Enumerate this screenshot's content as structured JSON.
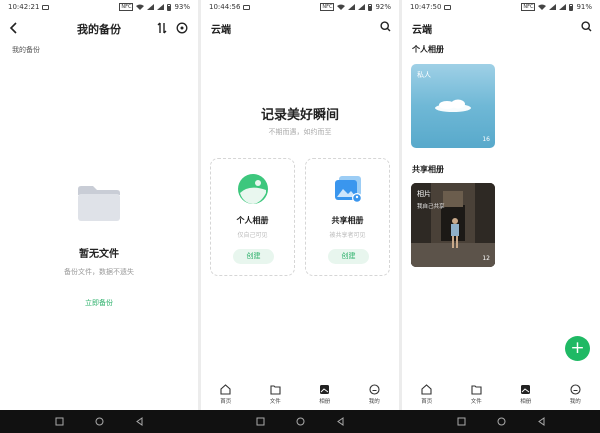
{
  "screens": [
    {
      "status": {
        "time": "10:42:21",
        "battery": "93%"
      },
      "header": {
        "title": "我的备份"
      },
      "section_label": "我的备份",
      "empty": {
        "title": "暂无文件",
        "subtitle": "备份文件，数据不遗失",
        "action": "立即备份"
      }
    },
    {
      "status": {
        "time": "10:44:56",
        "battery": "92%"
      },
      "app_title": "云端",
      "hero": {
        "title": "记录美好瞬间",
        "subtitle": "不期而遇，如约而至"
      },
      "cards": [
        {
          "title": "个人相册",
          "subtitle": "仅自己可见",
          "button": "创建"
        },
        {
          "title": "共享相册",
          "subtitle": "被共享者可见",
          "button": "创建"
        }
      ]
    },
    {
      "status": {
        "time": "10:47:50",
        "battery": "91%"
      },
      "app_title": "云端",
      "personal_section": "个人相册",
      "shared_section": "共享相册",
      "albums": [
        {
          "name": "私人",
          "count": "16"
        },
        {
          "name": "相片",
          "subtitle": "我自己共享",
          "count": "12"
        }
      ]
    }
  ],
  "status_nfc": "NFC",
  "bottom_nav": [
    "首页",
    "文件",
    "相册",
    "我的"
  ],
  "colors": {
    "accent": "#2bb06a",
    "fab": "#1fb964"
  },
  "icons": [
    "back-icon",
    "sort-icon",
    "target-icon",
    "folder-icon",
    "search-icon",
    "image-icon",
    "home-icon",
    "file-icon",
    "album-icon",
    "profile-icon",
    "plus-icon"
  ]
}
